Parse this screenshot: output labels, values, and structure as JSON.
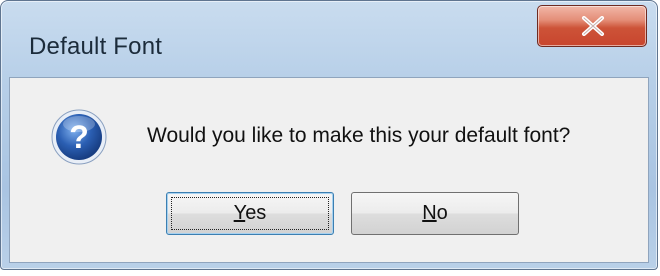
{
  "window": {
    "title": "Default Font",
    "close_icon": "close-x-icon"
  },
  "dialog": {
    "icon": "question-icon",
    "message": "Would you like to make this your default font?"
  },
  "buttons": {
    "yes": {
      "mnemonic": "Y",
      "rest": "es"
    },
    "no": {
      "mnemonic": "N",
      "rest": "o"
    }
  },
  "colors": {
    "title_bar": "#b7cfe8",
    "close_button": "#c8452e",
    "question_icon": "#2b5fb3"
  }
}
